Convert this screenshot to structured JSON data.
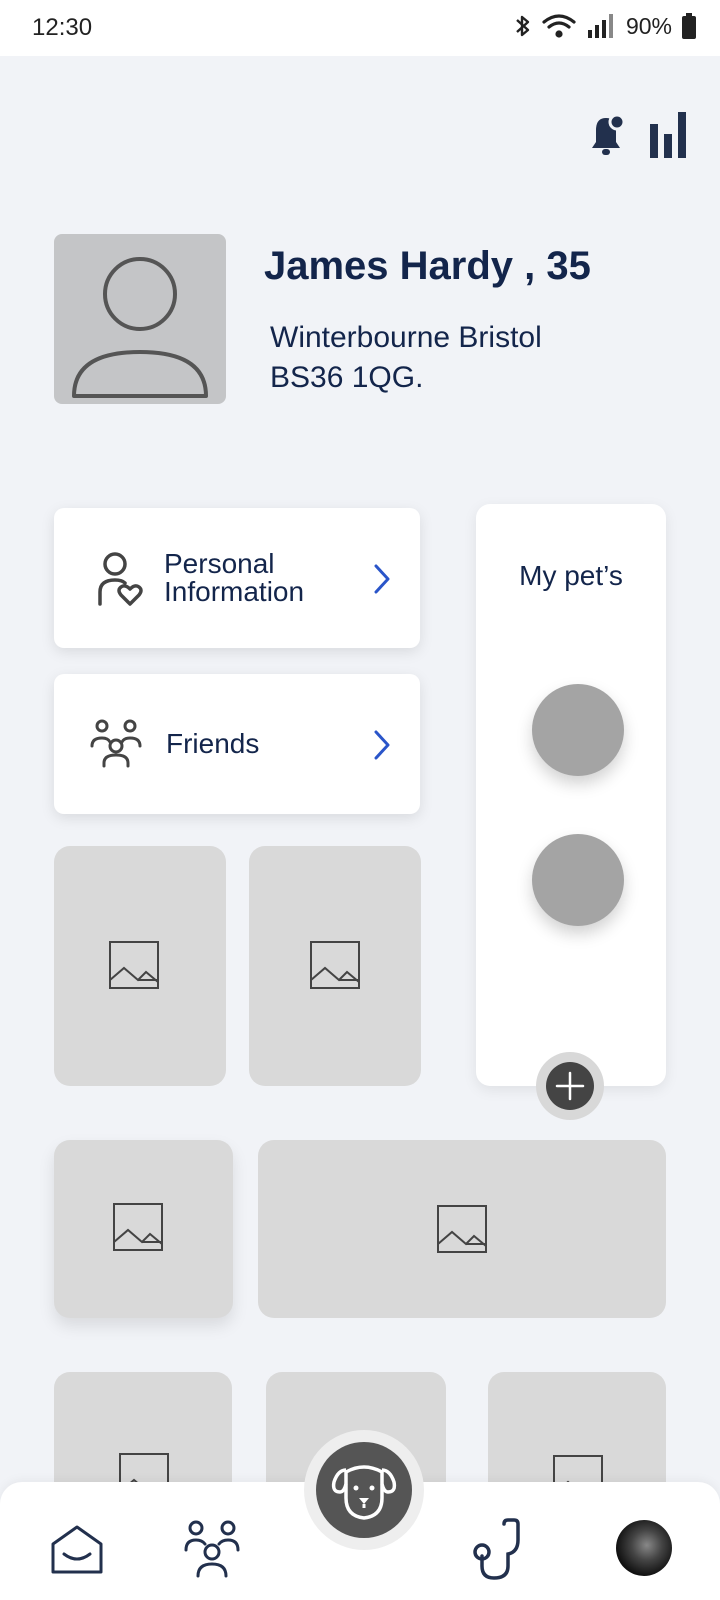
{
  "status_bar": {
    "time": "12:30",
    "battery": "90%",
    "icons": [
      "bluetooth-icon",
      "wifi-icon",
      "signal-icon",
      "battery-icon"
    ]
  },
  "top_actions": {
    "icons": [
      "notification-bell-icon",
      "stats-bar-icon"
    ]
  },
  "profile": {
    "name": "James Hardy , 35",
    "address_line1": "Winterbourne Bristol",
    "address_line2": "BS36 1QG."
  },
  "menu": {
    "personal_info_line1": "Personal",
    "personal_info_line2": "Information",
    "friends": "Friends"
  },
  "pets": {
    "title": "My pet’s",
    "count": 2
  },
  "colors": {
    "background": "#f1f3f7",
    "text_primary": "#13254b",
    "accent_chevron": "#2a55c9",
    "tile": "#d9d9d9",
    "nav_center": "#555555"
  },
  "bottom_nav": {
    "items": [
      "home-icon",
      "community-icon",
      "pet-dog-icon",
      "vet-stethoscope-icon",
      "user-avatar"
    ]
  }
}
